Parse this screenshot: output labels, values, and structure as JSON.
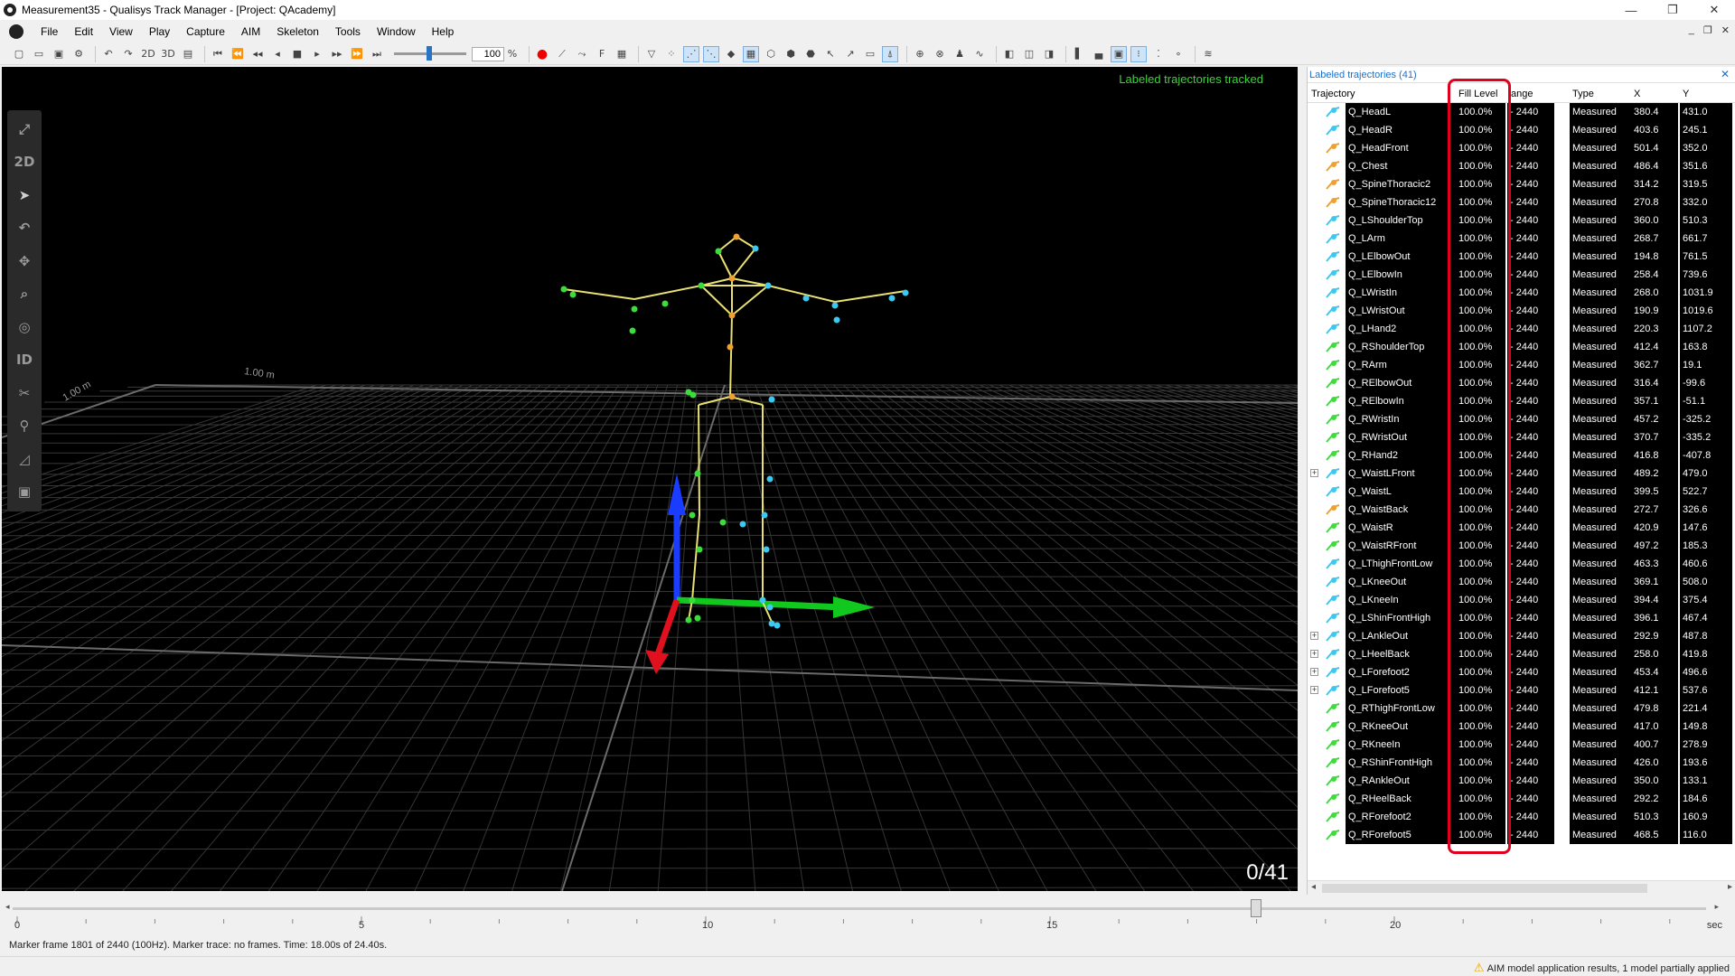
{
  "window": {
    "title": "Measurement35 - Qualisys Track Manager - [Project: QAcademy]",
    "controls": [
      "—",
      "❐",
      "✕"
    ]
  },
  "menu": [
    "File",
    "Edit",
    "View",
    "Play",
    "Capture",
    "AIM",
    "Skeleton",
    "Tools",
    "Window",
    "Help"
  ],
  "toolbar": {
    "view2d": "2D",
    "view3d": "3D",
    "speed_value": "100",
    "speed_unit": "%"
  },
  "viewport": {
    "status": "Labeled trajectories tracked",
    "counter": "0/41",
    "axis_labels": [
      "1.00 m",
      "1.00 m"
    ]
  },
  "tools": [
    {
      "icon": "expand-icon",
      "glyph": "⤢"
    },
    {
      "icon": "2d-view-icon",
      "glyph": "2D"
    },
    {
      "icon": "select-cursor-icon",
      "glyph": "➤"
    },
    {
      "icon": "rotate-icon",
      "glyph": "↶"
    },
    {
      "icon": "translate-icon",
      "glyph": "✥"
    },
    {
      "icon": "zoom-icon",
      "glyph": "⌕"
    },
    {
      "icon": "center-icon",
      "glyph": "◎"
    },
    {
      "icon": "identify-icon",
      "glyph": "ID"
    },
    {
      "icon": "cut-trajectory-icon",
      "glyph": "✂"
    },
    {
      "icon": "bone-icon",
      "glyph": "⚲"
    },
    {
      "icon": "selection-area-icon",
      "glyph": "◿"
    },
    {
      "icon": "volume-icon",
      "glyph": "▣"
    }
  ],
  "panel": {
    "title": "Labeled trajectories (41)",
    "columns": [
      "Trajectory",
      "Fill Level",
      "ange",
      "Type",
      "X",
      "Y"
    ],
    "rows": [
      {
        "name": "Q_HeadL",
        "fill": "100.0%",
        "range": "- 2440",
        "type": "Measured",
        "x": "380.4",
        "y": "431.0",
        "color": "#3cc8f0",
        "expand": false
      },
      {
        "name": "Q_HeadR",
        "fill": "100.0%",
        "range": "- 2440",
        "type": "Measured",
        "x": "403.6",
        "y": "245.1",
        "color": "#3cc8f0",
        "expand": false
      },
      {
        "name": "Q_HeadFront",
        "fill": "100.0%",
        "range": "- 2440",
        "type": "Measured",
        "x": "501.4",
        "y": "352.0",
        "color": "#f0a030",
        "expand": false
      },
      {
        "name": "Q_Chest",
        "fill": "100.0%",
        "range": "- 2440",
        "type": "Measured",
        "x": "486.4",
        "y": "351.6",
        "color": "#f0a030",
        "expand": false
      },
      {
        "name": "Q_SpineThoracic2",
        "fill": "100.0%",
        "range": "- 2440",
        "type": "Measured",
        "x": "314.2",
        "y": "319.5",
        "color": "#f0a030",
        "expand": false
      },
      {
        "name": "Q_SpineThoracic12",
        "fill": "100.0%",
        "range": "- 2440",
        "type": "Measured",
        "x": "270.8",
        "y": "332.0",
        "color": "#f0a030",
        "expand": false
      },
      {
        "name": "Q_LShoulderTop",
        "fill": "100.0%",
        "range": "- 2440",
        "type": "Measured",
        "x": "360.0",
        "y": "510.3",
        "color": "#3cc8f0",
        "expand": false
      },
      {
        "name": "Q_LArm",
        "fill": "100.0%",
        "range": "- 2440",
        "type": "Measured",
        "x": "268.7",
        "y": "661.7",
        "color": "#3cc8f0",
        "expand": false
      },
      {
        "name": "Q_LElbowOut",
        "fill": "100.0%",
        "range": "- 2440",
        "type": "Measured",
        "x": "194.8",
        "y": "761.5",
        "color": "#3cc8f0",
        "expand": false
      },
      {
        "name": "Q_LElbowIn",
        "fill": "100.0%",
        "range": "- 2440",
        "type": "Measured",
        "x": "258.4",
        "y": "739.6",
        "color": "#3cc8f0",
        "expand": false
      },
      {
        "name": "Q_LWristIn",
        "fill": "100.0%",
        "range": "- 2440",
        "type": "Measured",
        "x": "268.0",
        "y": "1031.9",
        "color": "#3cc8f0",
        "expand": false
      },
      {
        "name": "Q_LWristOut",
        "fill": "100.0%",
        "range": "- 2440",
        "type": "Measured",
        "x": "190.9",
        "y": "1019.6",
        "color": "#3cc8f0",
        "expand": false
      },
      {
        "name": "Q_LHand2",
        "fill": "100.0%",
        "range": "- 2440",
        "type": "Measured",
        "x": "220.3",
        "y": "1107.2",
        "color": "#3cc8f0",
        "expand": false
      },
      {
        "name": "Q_RShoulderTop",
        "fill": "100.0%",
        "range": "- 2440",
        "type": "Measured",
        "x": "412.4",
        "y": "163.8",
        "color": "#3cdc3c",
        "expand": false
      },
      {
        "name": "Q_RArm",
        "fill": "100.0%",
        "range": "- 2440",
        "type": "Measured",
        "x": "362.7",
        "y": "19.1",
        "color": "#3cdc3c",
        "expand": false
      },
      {
        "name": "Q_RElbowOut",
        "fill": "100.0%",
        "range": "- 2440",
        "type": "Measured",
        "x": "316.4",
        "y": "-99.6",
        "color": "#3cdc3c",
        "expand": false
      },
      {
        "name": "Q_RElbowIn",
        "fill": "100.0%",
        "range": "- 2440",
        "type": "Measured",
        "x": "357.1",
        "y": "-51.1",
        "color": "#3cdc3c",
        "expand": false
      },
      {
        "name": "Q_RWristIn",
        "fill": "100.0%",
        "range": "- 2440",
        "type": "Measured",
        "x": "457.2",
        "y": "-325.2",
        "color": "#3cdc3c",
        "expand": false
      },
      {
        "name": "Q_RWristOut",
        "fill": "100.0%",
        "range": "- 2440",
        "type": "Measured",
        "x": "370.7",
        "y": "-335.2",
        "color": "#3cdc3c",
        "expand": false
      },
      {
        "name": "Q_RHand2",
        "fill": "100.0%",
        "range": "- 2440",
        "type": "Measured",
        "x": "416.8",
        "y": "-407.8",
        "color": "#3cdc3c",
        "expand": false
      },
      {
        "name": "Q_WaistLFront",
        "fill": "100.0%",
        "range": "- 2440",
        "type": "Measured",
        "x": "489.2",
        "y": "479.0",
        "color": "#3cc8f0",
        "expand": true
      },
      {
        "name": "Q_WaistL",
        "fill": "100.0%",
        "range": "- 2440",
        "type": "Measured",
        "x": "399.5",
        "y": "522.7",
        "color": "#3cc8f0",
        "expand": false
      },
      {
        "name": "Q_WaistBack",
        "fill": "100.0%",
        "range": "- 2440",
        "type": "Measured",
        "x": "272.7",
        "y": "326.6",
        "color": "#f0a030",
        "expand": false
      },
      {
        "name": "Q_WaistR",
        "fill": "100.0%",
        "range": "- 2440",
        "type": "Measured",
        "x": "420.9",
        "y": "147.6",
        "color": "#3cdc3c",
        "expand": false
      },
      {
        "name": "Q_WaistRFront",
        "fill": "100.0%",
        "range": "- 2440",
        "type": "Measured",
        "x": "497.2",
        "y": "185.3",
        "color": "#3cdc3c",
        "expand": false
      },
      {
        "name": "Q_LThighFrontLow",
        "fill": "100.0%",
        "range": "- 2440",
        "type": "Measured",
        "x": "463.3",
        "y": "460.6",
        "color": "#3cc8f0",
        "expand": false
      },
      {
        "name": "Q_LKneeOut",
        "fill": "100.0%",
        "range": "- 2440",
        "type": "Measured",
        "x": "369.1",
        "y": "508.0",
        "color": "#3cc8f0",
        "expand": false
      },
      {
        "name": "Q_LKneeIn",
        "fill": "100.0%",
        "range": "- 2440",
        "type": "Measured",
        "x": "394.4",
        "y": "375.4",
        "color": "#3cc8f0",
        "expand": false
      },
      {
        "name": "Q_LShinFrontHigh",
        "fill": "100.0%",
        "range": "- 2440",
        "type": "Measured",
        "x": "396.1",
        "y": "467.4",
        "color": "#3cc8f0",
        "expand": false
      },
      {
        "name": "Q_LAnkleOut",
        "fill": "100.0%",
        "range": "- 2440",
        "type": "Measured",
        "x": "292.9",
        "y": "487.8",
        "color": "#3cc8f0",
        "expand": true
      },
      {
        "name": "Q_LHeelBack",
        "fill": "100.0%",
        "range": "- 2440",
        "type": "Measured",
        "x": "258.0",
        "y": "419.8",
        "color": "#3cc8f0",
        "expand": true
      },
      {
        "name": "Q_LForefoot2",
        "fill": "100.0%",
        "range": "- 2440",
        "type": "Measured",
        "x": "453.4",
        "y": "496.6",
        "color": "#3cc8f0",
        "expand": true
      },
      {
        "name": "Q_LForefoot5",
        "fill": "100.0%",
        "range": "- 2440",
        "type": "Measured",
        "x": "412.1",
        "y": "537.6",
        "color": "#3cc8f0",
        "expand": true
      },
      {
        "name": "Q_RThighFrontLow",
        "fill": "100.0%",
        "range": "- 2440",
        "type": "Measured",
        "x": "479.8",
        "y": "221.4",
        "color": "#3cdc3c",
        "expand": false
      },
      {
        "name": "Q_RKneeOut",
        "fill": "100.0%",
        "range": "- 2440",
        "type": "Measured",
        "x": "417.0",
        "y": "149.8",
        "color": "#3cdc3c",
        "expand": false
      },
      {
        "name": "Q_RKneeIn",
        "fill": "100.0%",
        "range": "- 2440",
        "type": "Measured",
        "x": "400.7",
        "y": "278.9",
        "color": "#3cdc3c",
        "expand": false
      },
      {
        "name": "Q_RShinFrontHigh",
        "fill": "100.0%",
        "range": "- 2440",
        "type": "Measured",
        "x": "426.0",
        "y": "193.6",
        "color": "#3cdc3c",
        "expand": false
      },
      {
        "name": "Q_RAnkleOut",
        "fill": "100.0%",
        "range": "- 2440",
        "type": "Measured",
        "x": "350.0",
        "y": "133.1",
        "color": "#3cdc3c",
        "expand": false
      },
      {
        "name": "Q_RHeelBack",
        "fill": "100.0%",
        "range": "- 2440",
        "type": "Measured",
        "x": "292.2",
        "y": "184.6",
        "color": "#3cdc3c",
        "expand": false
      },
      {
        "name": "Q_RForefoot2",
        "fill": "100.0%",
        "range": "- 2440",
        "type": "Measured",
        "x": "510.3",
        "y": "160.9",
        "color": "#3cdc3c",
        "expand": false
      },
      {
        "name": "Q_RForefoot5",
        "fill": "100.0%",
        "range": "- 2440",
        "type": "Measured",
        "x": "468.5",
        "y": "116.0",
        "color": "#3cdc3c",
        "expand": false
      }
    ]
  },
  "timeline": {
    "labels": [
      "0",
      "5",
      "10",
      "15",
      "20"
    ],
    "unit": "sec",
    "position_fraction": 0.7377
  },
  "status": {
    "left": "Marker frame 1801 of 2440 (100Hz). Marker trace: no frames. Time: 18.00s of 24.40s.",
    "right": "AIM model application results, 1 model partially applied"
  },
  "colors": {
    "accent": "#1e70c8",
    "highlight": "#e0001e",
    "status_green": "#3ad43a"
  }
}
